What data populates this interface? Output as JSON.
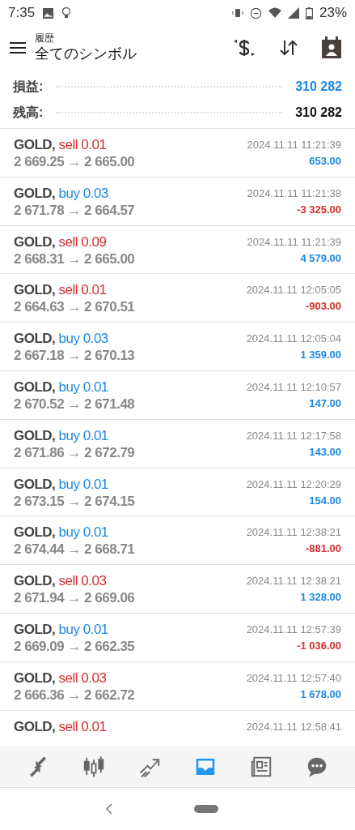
{
  "status_bar": {
    "time": "7:35",
    "battery": "23%"
  },
  "app_bar": {
    "subtitle": "履歴",
    "title": "全てのシンボル"
  },
  "summary": [
    {
      "label": "損益:",
      "value": "310 282",
      "highlight": true
    },
    {
      "label": "残高:",
      "value": "310 282",
      "highlight": false
    }
  ],
  "trades": [
    {
      "symbol": "GOLD,",
      "kind": "sell",
      "volume": "0.01",
      "prices": "2 669.25 → 2 665.00",
      "time": "2024.11.11 11:21:39",
      "profit": "653.00",
      "loss": false
    },
    {
      "symbol": "GOLD,",
      "kind": "buy",
      "volume": "0.03",
      "prices": "2 671.78 → 2 664.57",
      "time": "2024.11.11 11:21:38",
      "profit": "-3 325.00",
      "loss": true
    },
    {
      "symbol": "GOLD,",
      "kind": "sell",
      "volume": "0.09",
      "prices": "2 668.31 → 2 665.00",
      "time": "2024.11.11 11:21:39",
      "profit": "4 579.00",
      "loss": false
    },
    {
      "symbol": "GOLD,",
      "kind": "sell",
      "volume": "0.01",
      "prices": "2 664.63 → 2 670.51",
      "time": "2024.11.11 12:05:05",
      "profit": "-903.00",
      "loss": true
    },
    {
      "symbol": "GOLD,",
      "kind": "buy",
      "volume": "0.03",
      "prices": "2 667.18 → 2 670.13",
      "time": "2024.11.11 12:05:04",
      "profit": "1 359.00",
      "loss": false
    },
    {
      "symbol": "GOLD,",
      "kind": "buy",
      "volume": "0.01",
      "prices": "2 670.52 → 2 671.48",
      "time": "2024.11.11 12:10:57",
      "profit": "147.00",
      "loss": false
    },
    {
      "symbol": "GOLD,",
      "kind": "buy",
      "volume": "0.01",
      "prices": "2 671.86 → 2 672.79",
      "time": "2024.11.11 12:17:58",
      "profit": "143.00",
      "loss": false
    },
    {
      "symbol": "GOLD,",
      "kind": "buy",
      "volume": "0.01",
      "prices": "2 673.15 → 2 674.15",
      "time": "2024.11.11 12:20:29",
      "profit": "154.00",
      "loss": false
    },
    {
      "symbol": "GOLD,",
      "kind": "buy",
      "volume": "0.01",
      "prices": "2 674.44 → 2 668.71",
      "time": "2024.11.11 12:38:21",
      "profit": "-881.00",
      "loss": true
    },
    {
      "symbol": "GOLD,",
      "kind": "sell",
      "volume": "0.03",
      "prices": "2 671.94 → 2 669.06",
      "time": "2024.11.11 12:38:21",
      "profit": "1 328.00",
      "loss": false
    },
    {
      "symbol": "GOLD,",
      "kind": "buy",
      "volume": "0.01",
      "prices": "2 669.09 → 2 662.35",
      "time": "2024.11.11 12:57:39",
      "profit": "-1 036.00",
      "loss": true
    },
    {
      "symbol": "GOLD,",
      "kind": "sell",
      "volume": "0.03",
      "prices": "2 666.36 → 2 662.72",
      "time": "2024.11.11 12:57:40",
      "profit": "1 678.00",
      "loss": false
    },
    {
      "symbol": "GOLD,",
      "kind": "sell",
      "volume": "0.01",
      "time": "2024.11.11 12:58:41"
    }
  ],
  "bottom_tabs": [
    {
      "selected": false
    },
    {
      "selected": false
    },
    {
      "selected": false
    },
    {
      "selected": true
    },
    {
      "selected": false
    },
    {
      "selected": false
    }
  ]
}
